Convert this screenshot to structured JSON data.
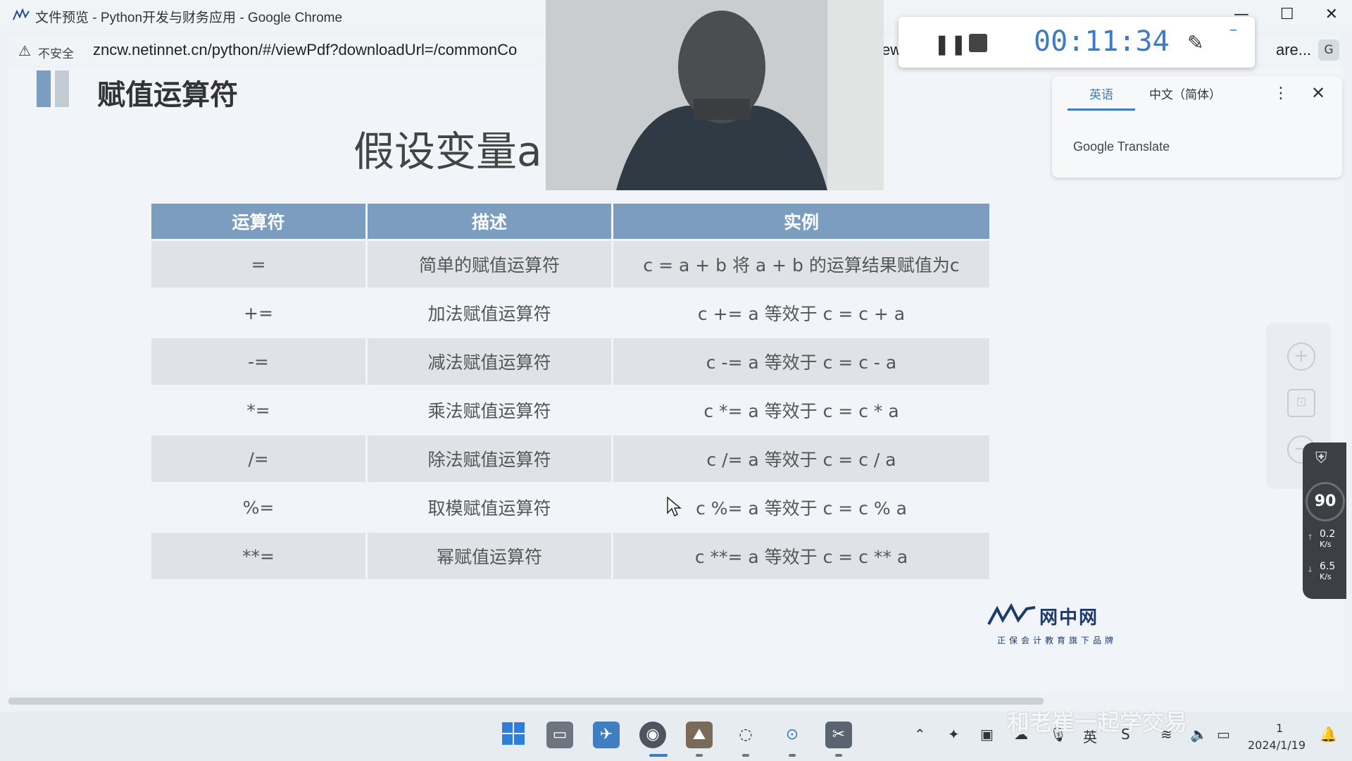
{
  "window": {
    "title": "文件预览 - Python开发与财务应用 - Google Chrome",
    "minimize": "—",
    "maximize": "☐",
    "close": "✕"
  },
  "addressbar": {
    "security_label": "不安全",
    "url": "zncw.netinnet.cn/python/#/viewPdf?downloadUrl=/commonCo",
    "url_tail": "ew",
    "url_right": "are..."
  },
  "slide": {
    "title": "赋值运算符",
    "subtitle": "假设变量a",
    "table": {
      "headers": [
        "运算符",
        "描述",
        "实例"
      ],
      "rows": [
        [
          "=",
          "简单的赋值运算符",
          "c = a + b 将 a + b 的运算结果赋值为c"
        ],
        [
          "+=",
          "加法赋值运算符",
          "c += a 等效于 c = c + a"
        ],
        [
          "-=",
          "减法赋值运算符",
          "c -= a 等效于 c = c - a"
        ],
        [
          "*=",
          "乘法赋值运算符",
          "c *= a 等效于 c = c * a"
        ],
        [
          "/=",
          "除法赋值运算符",
          "c /= a 等效于 c = c / a"
        ],
        [
          "%=",
          "取模赋值运算符",
          "c %= a 等效于 c = c % a"
        ],
        [
          "**=",
          "幂赋值运算符",
          "c **= a 等效于 c = c ** a"
        ]
      ]
    },
    "brand": {
      "name": "网中网",
      "tagline": "正保会计教育旗下品牌"
    }
  },
  "recorder": {
    "time": "00:11:34",
    "pause": "❚❚",
    "pen": "✎",
    "minimize": "–"
  },
  "translate": {
    "tab_en": "英语",
    "tab_zh": "中文（简体）",
    "more": "⋮",
    "close": "✕",
    "brand": "Google Translate"
  },
  "network": {
    "percent": "90",
    "upload": "0.2",
    "download": "6.5",
    "unit": "K/s"
  },
  "taskbar": {
    "clock_time": "1",
    "clock_date": "2024/1/19",
    "ime": "英",
    "watermark": "和老崔一起学交易"
  },
  "colors": {
    "header_bg": "#7b9dbf",
    "row_odd": "#dfe3e7",
    "timer": "#3d7bc4"
  }
}
